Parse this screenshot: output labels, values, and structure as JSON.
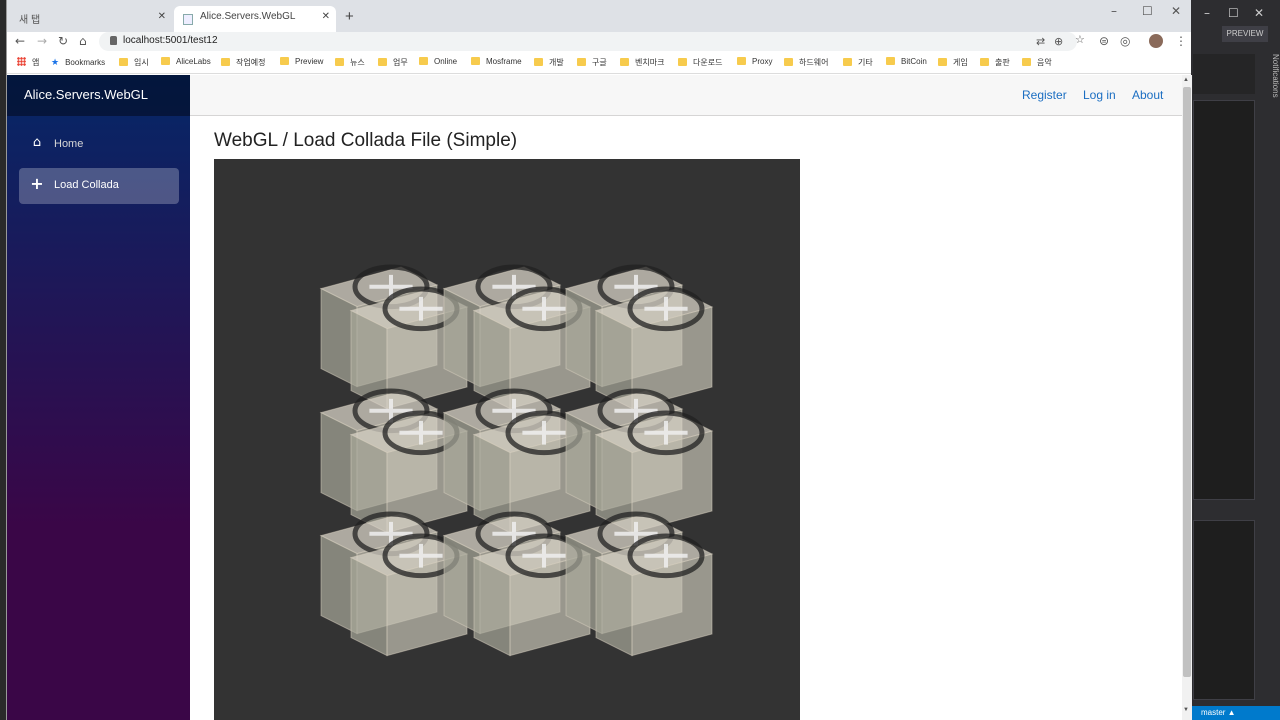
{
  "browser": {
    "tabs": [
      {
        "label": "새 탭",
        "active": false
      },
      {
        "label": "Alice.Servers.WebGL",
        "active": true
      }
    ],
    "new_tab_symbol": "+",
    "url": "localhost:5001/test12",
    "bookmarks": [
      {
        "label": "앱",
        "icon": "apps-icon"
      },
      {
        "label": "Bookmarks",
        "icon": "star-icon"
      },
      {
        "label": "임시",
        "icon": "folder-icon"
      },
      {
        "label": "AliceLabs",
        "icon": "folder-icon"
      },
      {
        "label": "작업예정",
        "icon": "folder-icon"
      },
      {
        "label": "Preview",
        "icon": "folder-icon"
      },
      {
        "label": "뉴스",
        "icon": "folder-icon"
      },
      {
        "label": "업무",
        "icon": "folder-icon"
      },
      {
        "label": "Online",
        "icon": "folder-icon"
      },
      {
        "label": "Mosframe",
        "icon": "folder-icon"
      },
      {
        "label": "개발",
        "icon": "folder-icon"
      },
      {
        "label": "구글",
        "icon": "folder-icon"
      },
      {
        "label": "벤치마크",
        "icon": "folder-icon"
      },
      {
        "label": "다운로드",
        "icon": "folder-icon"
      },
      {
        "label": "Proxy",
        "icon": "folder-icon"
      },
      {
        "label": "하드웨어",
        "icon": "folder-icon"
      },
      {
        "label": "기타",
        "icon": "folder-icon"
      },
      {
        "label": "BitCoin",
        "icon": "folder-icon"
      },
      {
        "label": "게임",
        "icon": "folder-icon"
      },
      {
        "label": "출판",
        "icon": "folder-icon"
      },
      {
        "label": "음악",
        "icon": "folder-icon"
      }
    ]
  },
  "app": {
    "brand": "Alice.Servers.WebGL",
    "nav": [
      {
        "label": "Home",
        "icon": "home-icon",
        "active": false
      },
      {
        "label": "Load Collada",
        "icon": "plus-icon",
        "active": true
      }
    ],
    "top_links": [
      "Register",
      "Log in",
      "About"
    ],
    "page_title": "WebGL / Load Collada File (Simple)"
  },
  "ide": {
    "preview_label": "PREVIEW",
    "notifications_label": "Notifications",
    "branch": "master"
  },
  "colors": {
    "sidebar_top": "#052767",
    "sidebar_bottom": "#3a0647",
    "link": "#1b6ec2",
    "canvas_bg": "#333333"
  }
}
